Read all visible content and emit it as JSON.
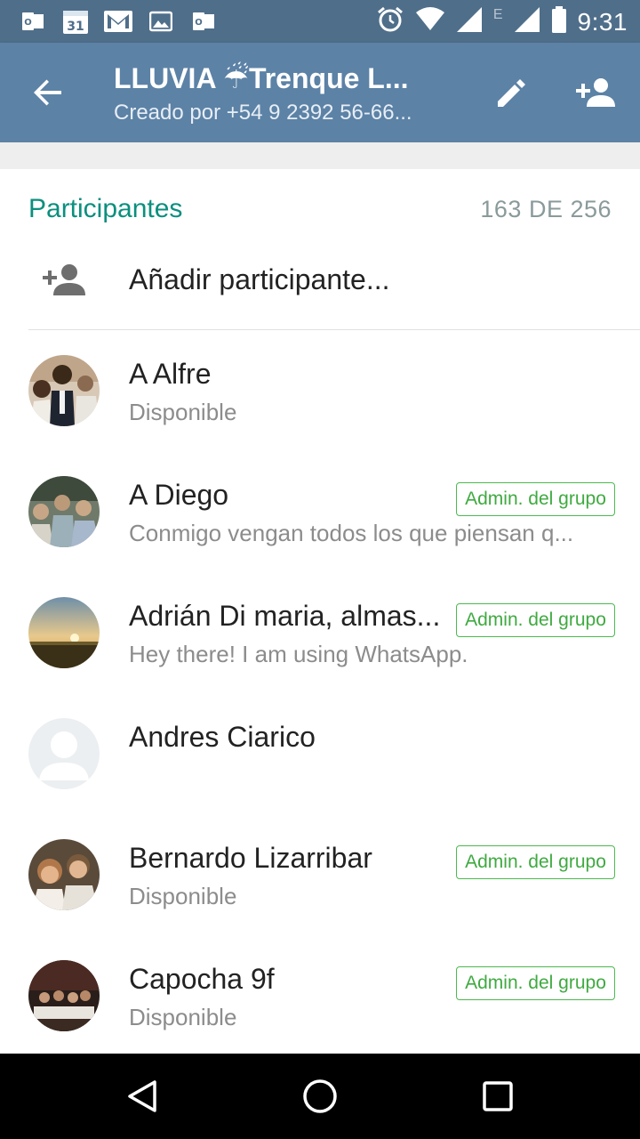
{
  "status_bar": {
    "time": "9:31",
    "network_letter": "E",
    "left_icons": [
      "outlook-icon",
      "calendar-icon",
      "gmail-icon",
      "gallery-icon",
      "outlook-icon"
    ],
    "calendar_day": "31"
  },
  "app_bar": {
    "title": "LLUVIA ☔Trenque L...",
    "subtitle": "Creado por +54 9 2392 56-66...",
    "color": "#5c82a6"
  },
  "section": {
    "title": "Participantes",
    "count": "163 DE 256"
  },
  "add_participant": {
    "label": "Añadir participante..."
  },
  "participants": [
    {
      "name": "A Alfre",
      "status": "Disponible",
      "admin": ""
    },
    {
      "name": "A Diego",
      "status": "Conmigo vengan todos los que piensan  q...",
      "admin": "Admin. del grupo"
    },
    {
      "name": "Adrián Di maria, almas...",
      "status": "Hey there! I am using WhatsApp.",
      "admin": "Admin. del grupo"
    },
    {
      "name": "Andres Ciarico",
      "status": "",
      "admin": ""
    },
    {
      "name": "Bernardo Lizarribar",
      "status": "Disponible",
      "admin": "Admin. del grupo"
    },
    {
      "name": "Capocha 9f",
      "status": "Disponible",
      "admin": "Admin. del grupo"
    }
  ],
  "colors": {
    "accent": "#0b8f7e",
    "badge": "#4cb94e",
    "status_bar": "#4f6e8a"
  }
}
